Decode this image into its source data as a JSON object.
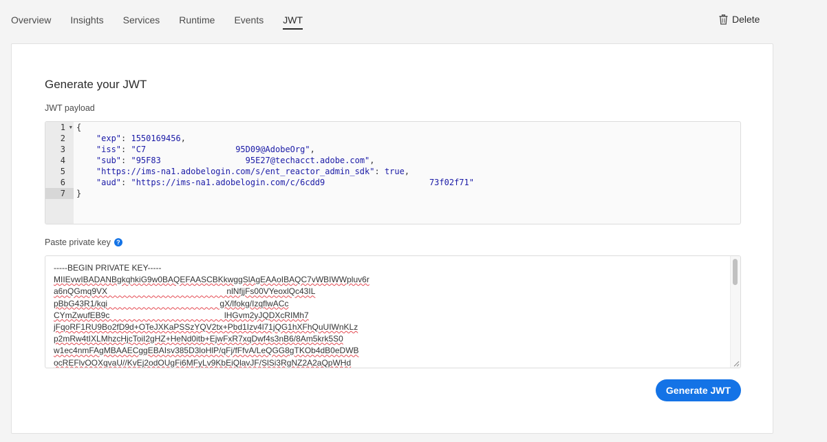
{
  "nav": {
    "tabs": [
      {
        "label": "Overview"
      },
      {
        "label": "Insights"
      },
      {
        "label": "Services"
      },
      {
        "label": "Runtime"
      },
      {
        "label": "Events"
      },
      {
        "label": "JWT",
        "active": true
      }
    ],
    "delete_label": "Delete"
  },
  "card": {
    "title": "Generate your JWT",
    "payload_label": "JWT payload",
    "private_key_label": "Paste private key",
    "generate_button": "Generate JWT"
  },
  "editor": {
    "line_numbers": [
      "1",
      "2",
      "3",
      "4",
      "5",
      "6",
      "7"
    ],
    "lines": [
      {
        "parts": [
          [
            "punct",
            "{"
          ]
        ]
      },
      {
        "parts": [
          [
            "punct",
            "    "
          ],
          [
            "key",
            "\"exp\""
          ],
          [
            "punct",
            ": "
          ],
          [
            "num",
            "1550169456"
          ],
          [
            "punct",
            ","
          ]
        ]
      },
      {
        "parts": [
          [
            "punct",
            "    "
          ],
          [
            "key",
            "\"iss\""
          ],
          [
            "punct",
            ": "
          ],
          [
            "str",
            "\"C7                  95D09@AdobeOrg\""
          ],
          [
            "punct",
            ","
          ]
        ]
      },
      {
        "parts": [
          [
            "punct",
            "    "
          ],
          [
            "key",
            "\"sub\""
          ],
          [
            "punct",
            ": "
          ],
          [
            "str",
            "\"95F83                 95E27@techacct.adobe.com\""
          ],
          [
            "punct",
            ","
          ]
        ]
      },
      {
        "parts": [
          [
            "punct",
            "    "
          ],
          [
            "key",
            "\"https://ims-na1.adobelogin.com/s/ent_reactor_admin_sdk\""
          ],
          [
            "punct",
            ": "
          ],
          [
            "bool",
            "true"
          ],
          [
            "punct",
            ","
          ]
        ]
      },
      {
        "parts": [
          [
            "punct",
            "    "
          ],
          [
            "key",
            "\"aud\""
          ],
          [
            "punct",
            ": "
          ],
          [
            "str",
            "\"https://ims-na1.adobelogin.com/c/6cdd9                     73f02f71\""
          ]
        ]
      },
      {
        "parts": [
          [
            "punct",
            "}"
          ]
        ]
      }
    ]
  },
  "private_key": {
    "lines": [
      "-----BEGIN PRIVATE KEY-----",
      "MIIEvwIBADANBgkqhkiG9w0BAQEFAASCBKkwggSlAgEAAoIBAQC7vWBIWWpluv6r",
      "a6nQGmq9VX                                                    nlNfjjFs00VYeoxlQc43IL",
      "pBbG43R1/kqi                                                 gX/lfokg/IzqflwACc",
      "CYmZwufEB9c                                                  lHGvm2yJQDXcRIMh7",
      "jFqoRF1RU9Bo2fD9d+OTeJXKaPSSzYQV2tx+Pbd1Izv4l71jQG1hXFhQuUIWnKLz",
      "p2mRw4tIXLMhzcHjcToiI2gHZ+HeNd0itb+EjwFxR7xqDwf4s3nB6/8Am5krk5S0",
      "w1ec4nmFAgMBAAECggEBAIsv385D3loHlP/qFj/fFfvA/LeQGG8gTKOb4dB0eDWB",
      "ocREFlvOOXqvaU//KvEj2odOUgFi6MFyLv9KbEiQlavJF/SlSi3RgNZ2A2aQpWHd"
    ]
  }
}
